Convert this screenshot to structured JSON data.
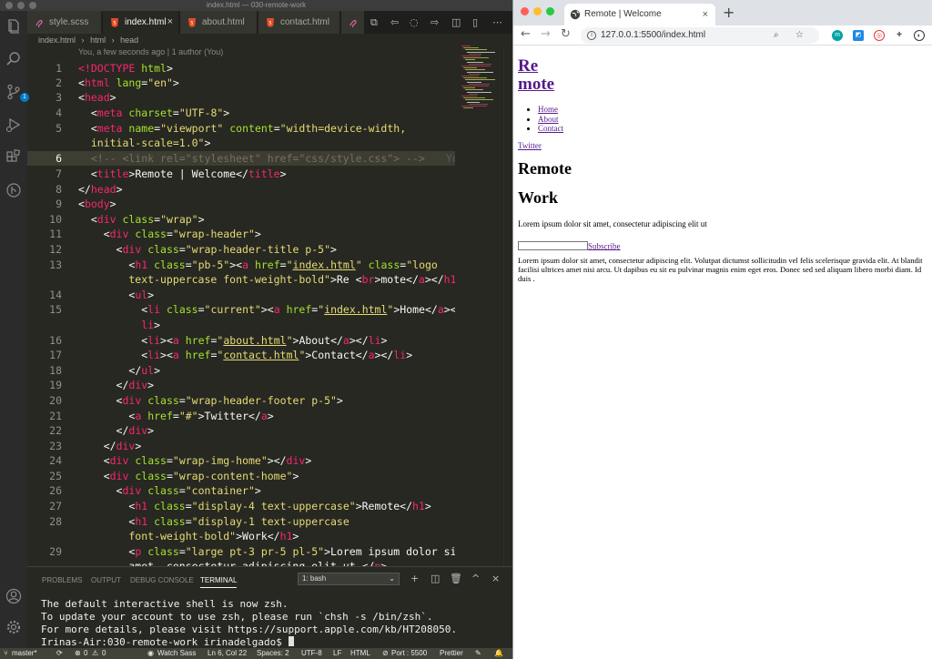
{
  "vscode": {
    "window_title": "index.html — 030-remote-work",
    "tabs": [
      {
        "label": "style.scss"
      },
      {
        "label": "index.html",
        "close": "×"
      },
      {
        "label": "about.html"
      },
      {
        "label": "contact.html"
      }
    ],
    "breadcrumb": [
      "index.html",
      "html",
      "head"
    ],
    "blame": "You, a few seconds ago | 1 author (You)",
    "scm_badge": "1",
    "inline_blame": "Yo",
    "line_numbers": [
      "1",
      "2",
      "3",
      "4",
      "5",
      "",
      "6",
      "7",
      "8",
      "9",
      "10",
      "11",
      "12",
      "13",
      "",
      "14",
      "15",
      "",
      "16",
      "17",
      "18",
      "19",
      "20",
      "21",
      "22",
      "23",
      "24",
      "25",
      "26",
      "27",
      "28",
      "",
      "29"
    ],
    "panel": {
      "tabs": [
        "PROBLEMS",
        "OUTPUT",
        "DEBUG CONSOLE",
        "TERMINAL"
      ],
      "terminal_select": "1: bash",
      "terminal_lines": [
        "The default interactive shell is now zsh.",
        "To update your account to use zsh, please run `chsh -s /bin/zsh`.",
        "For more details, please visit https://support.apple.com/kb/HT208050.",
        "Irinas-Air:030-remote-work irinadelgado$ "
      ]
    },
    "status": {
      "branch": "master*",
      "problems": "0",
      "warnings": "0",
      "watch": "Watch Sass",
      "position": "Ln 6, Col 22",
      "spaces": "Spaces: 2",
      "encoding": "UTF-8",
      "eol": "LF",
      "language": "HTML",
      "port": "Port : 5500",
      "formatter": "Prettier"
    }
  },
  "browser": {
    "tab_title": "Remote | Welcome",
    "tab_close": "×",
    "new_tab": "+",
    "url": "127.0.0.1:5500/index.html",
    "page": {
      "logo_line1": "Re",
      "logo_line2": "mote",
      "nav": [
        "Home",
        "About",
        "Contact"
      ],
      "twitter": "Twitter",
      "heading1": "Remote",
      "heading2": "Work",
      "intro": "Lorem ipsum dolor sit amet, consectetur adipiscing elit ut",
      "subscribe": "Subscribe",
      "body_text": "Lorem ipsum dolor sit amet, consectetur adipiscing elit. Volutpat dictumst sollicitudin vel felis scelerisque gravida elit. At blandit facilisi ultrices amet nisi arcu. Ut dapibus eu sit eu pulvinar magnis enim eget eros. Donec sed sed aliquam libero morbi diam. Id duis ."
    }
  },
  "colors": {
    "vscode_bg": "#272822",
    "tag": "#f92672",
    "attr": "#a6e22e",
    "string": "#e6db74",
    "comment": "#75715e",
    "link_visited": "#551a8b"
  }
}
